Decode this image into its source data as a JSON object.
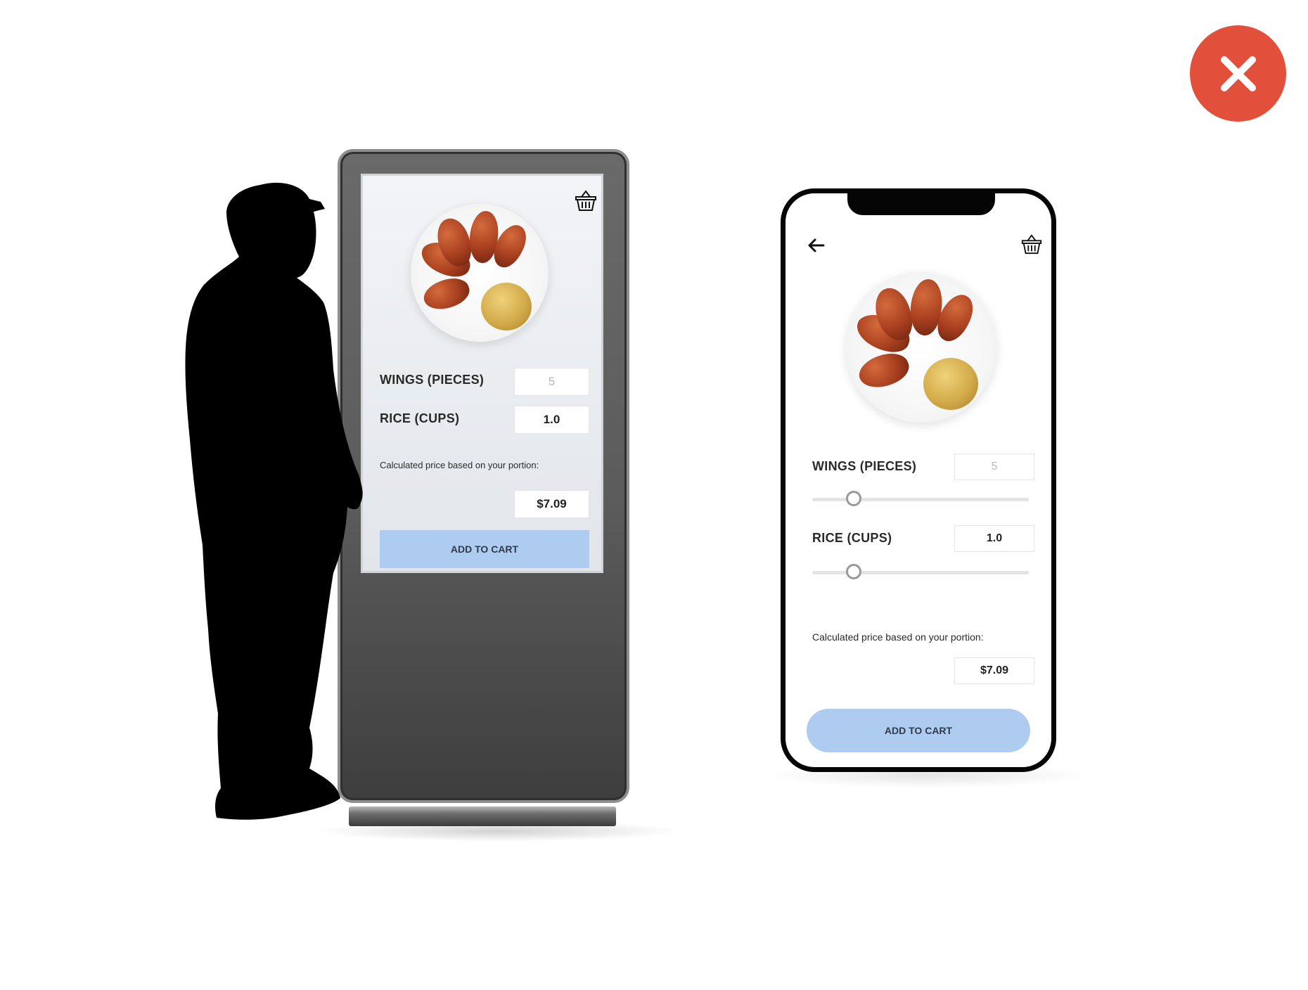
{
  "close_badge": {
    "icon": "close-icon",
    "color": "#e2503b"
  },
  "kiosk": {
    "wings_label": "WINGS (PIECES)",
    "wings_value": "5",
    "rice_label": "RICE (CUPS)",
    "rice_value": "1.0",
    "price_caption": "Calculated price based on your portion:",
    "price_value": "$7.09",
    "add_to_cart_label": "ADD TO CART",
    "basket_icon": "basket-icon"
  },
  "phone": {
    "back_icon": "back-arrow-icon",
    "basket_icon": "basket-icon",
    "wings_label": "WINGS (PIECES)",
    "wings_value": "5",
    "wings_slider_fraction": 0.19,
    "rice_label": "RICE (CUPS)",
    "rice_value": "1.0",
    "rice_slider_fraction": 0.19,
    "price_caption": "Calculated price based on your portion:",
    "price_value": "$7.09",
    "add_to_cart_label": "ADD TO CART"
  },
  "colors": {
    "accent_button": "#aecbf0",
    "close_red": "#e2503b"
  }
}
